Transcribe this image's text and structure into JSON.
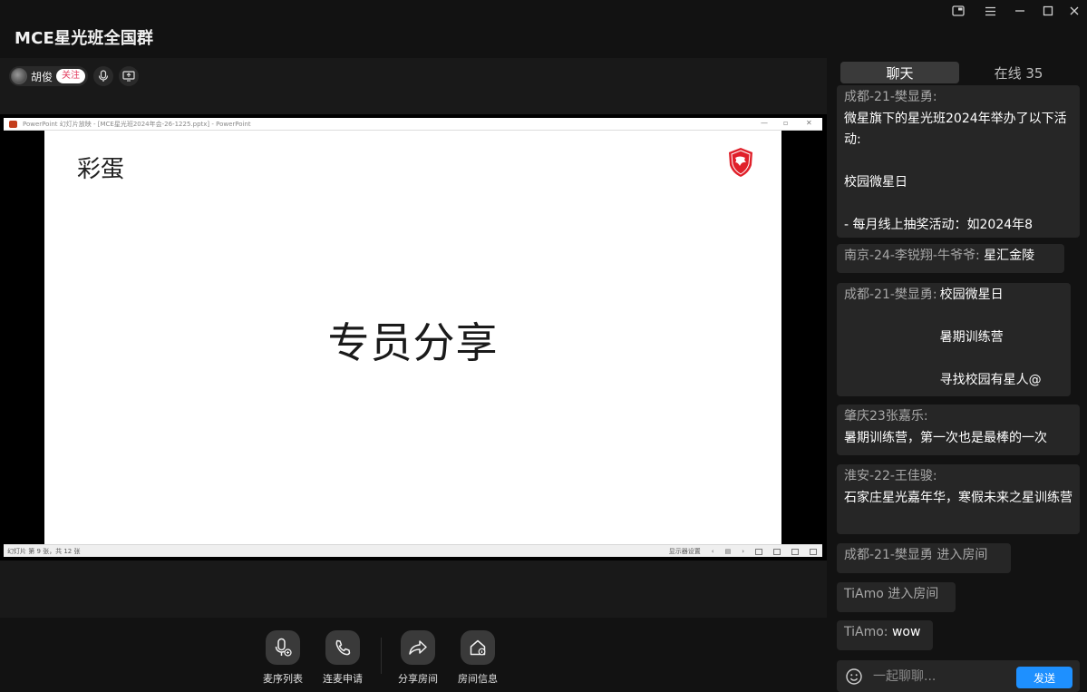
{
  "window": {
    "title": "MCE星光班全国群"
  },
  "host": {
    "name": "胡俊",
    "follow_label": "关注"
  },
  "shared_screen": {
    "ppt_title": "PowerPoint 幻灯片放映 - [MCE星光班2024年会-26-1225.pptx] - PowerPoint",
    "slide_corner_text": "彩蛋",
    "slide_main_text": "专员分享",
    "status_left": "幻灯片 第 9 张，共 12 张",
    "status_display_settings": "显示器设置"
  },
  "toolbar": {
    "items": [
      {
        "label": "麦序列表",
        "icon": "mic-list-icon"
      },
      {
        "label": "连麦申请",
        "icon": "phone-icon"
      },
      {
        "label": "分享房间",
        "icon": "share-icon"
      },
      {
        "label": "房间信息",
        "icon": "house-info-icon"
      }
    ]
  },
  "chat": {
    "tabs": [
      {
        "label": "聊天",
        "active": true
      },
      {
        "label": "在线 35",
        "active": false
      }
    ],
    "messages": [
      {
        "who": "成都-21-樊显勇:",
        "text": "微星旗下的星光班2024年举办了以下活动:\n\n校园微星日\n\n- 每月线上抽奖活动：如2024年8"
      },
      {
        "who": "南京-24-李锐翔-牛爷爷:",
        "text": "星汇金陵"
      },
      {
        "who": "成都-21-樊显勇:",
        "text": "校园微星日\n\n暑期训练营\n\n寻找校园有星人@"
      },
      {
        "who": "肇庆23张嘉乐:",
        "text": "暑期训练营，第一次也是最棒的一次"
      },
      {
        "who": "淮安-22-王佳骏:",
        "text": "石家庄星光嘉年华，寒假未来之星训练营"
      },
      {
        "who": "成都-21-樊显勇 进入房间",
        "text": ""
      },
      {
        "who": "TiAmo 进入房间",
        "text": ""
      },
      {
        "who": "TiAmo:",
        "text": "wow"
      }
    ],
    "input_placeholder": "一起聊聊...",
    "send_label": "发送"
  }
}
